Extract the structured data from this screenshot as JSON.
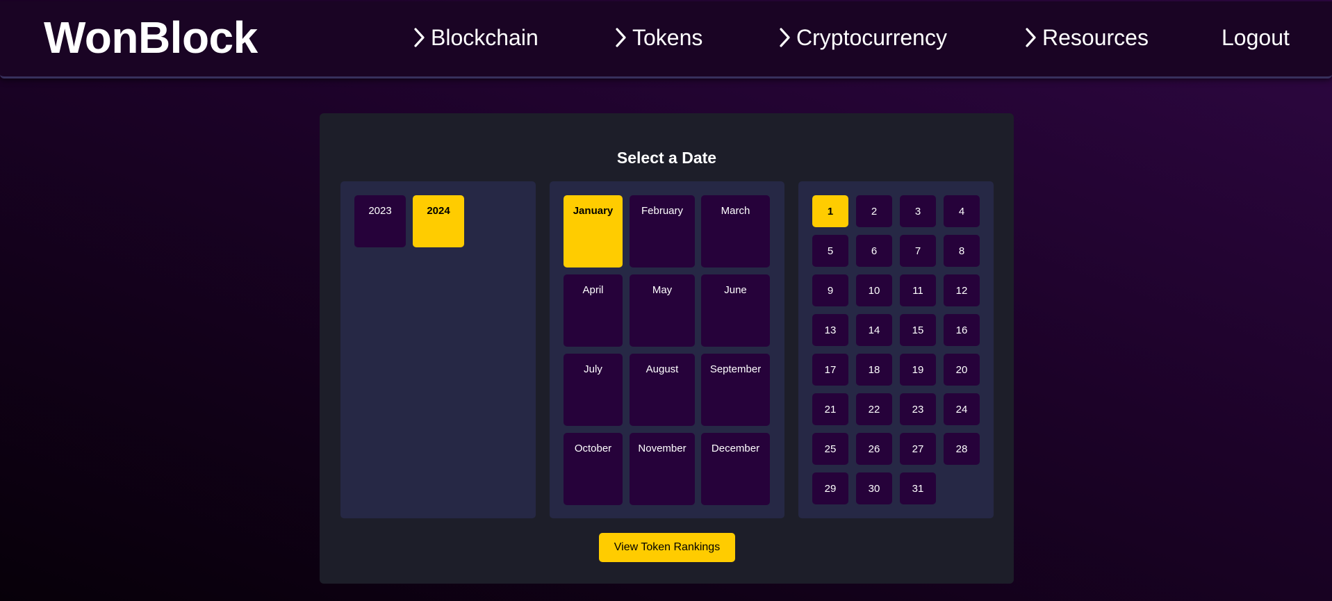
{
  "header": {
    "logo": "WonBlock",
    "nav": [
      "Blockchain",
      "Tokens",
      "Cryptocurrency",
      "Resources"
    ],
    "logout": "Logout",
    "nav_icon": "chevron-right-icon"
  },
  "picker": {
    "title": "Select a Date",
    "years": [
      "2023",
      "2024"
    ],
    "selected_year": "2024",
    "months": [
      "January",
      "February",
      "March",
      "April",
      "May",
      "June",
      "July",
      "August",
      "September",
      "October",
      "November",
      "December"
    ],
    "selected_month": "January",
    "days": [
      "1",
      "2",
      "3",
      "4",
      "5",
      "6",
      "7",
      "8",
      "9",
      "10",
      "11",
      "12",
      "13",
      "14",
      "15",
      "16",
      "17",
      "18",
      "19",
      "20",
      "21",
      "22",
      "23",
      "24",
      "25",
      "26",
      "27",
      "28",
      "29",
      "30",
      "31"
    ],
    "selected_day": "1",
    "button_label": "View Token Rankings"
  },
  "colors": {
    "accent": "#ffcc00",
    "tile": "#26023a",
    "panel": "#262845",
    "card": "#1d1e29"
  }
}
